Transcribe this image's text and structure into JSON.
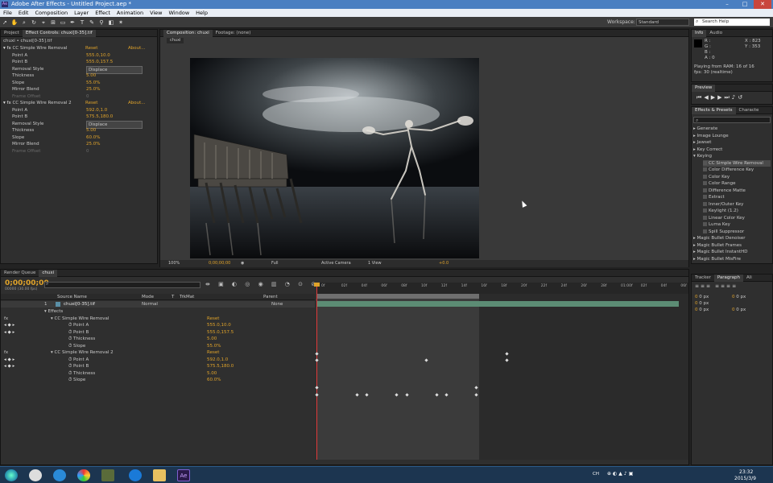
{
  "title": "Adobe After Effects - Untitled Project.aep *",
  "menu": [
    "File",
    "Edit",
    "Composition",
    "Layer",
    "Effect",
    "Animation",
    "View",
    "Window",
    "Help"
  ],
  "workspace": {
    "label": "Workspace:",
    "value": "Standard",
    "search": "Search Help"
  },
  "project_tab": "Project",
  "effect_controls": {
    "tab": "Effect Controls: chuxi[0-35].tif",
    "header": "chuxi • chuxi[0-35].tif",
    "effects": [
      {
        "name": "CC Simple Wire Removal",
        "reset": "Reset",
        "about": "About...",
        "props": [
          {
            "n": "Point A",
            "v": "555.0,10.0"
          },
          {
            "n": "Point B",
            "v": "555.0,157.5"
          },
          {
            "n": "Removal Style",
            "v": "Displace"
          },
          {
            "n": "Thickness",
            "v": "5.00"
          },
          {
            "n": "Slope",
            "v": "55.0%"
          },
          {
            "n": "Mirror Blend",
            "v": "25.0%"
          },
          {
            "n": "Frame Offset",
            "v": "0"
          }
        ]
      },
      {
        "name": "CC Simple Wire Removal 2",
        "reset": "Reset",
        "about": "About...",
        "props": [
          {
            "n": "Point A",
            "v": "592.0,1.0"
          },
          {
            "n": "Point B",
            "v": "575.5,180.0"
          },
          {
            "n": "Removal Style",
            "v": "Displace"
          },
          {
            "n": "Thickness",
            "v": "5.00"
          },
          {
            "n": "Slope",
            "v": "60.0%"
          },
          {
            "n": "Mirror Blend",
            "v": "25.0%"
          },
          {
            "n": "Frame Offset",
            "v": "0"
          }
        ]
      }
    ]
  },
  "composition": {
    "tab": "Composition: chuxi",
    "footage_tab": "Footage: (none)",
    "crumb": "chuxi",
    "zoom": "100%",
    "timecode": "0;00;00;00",
    "resolution": "Full",
    "camera": "Active Camera",
    "views": "1 View",
    "exposure": "+0.0"
  },
  "info": {
    "tabs": [
      "Info",
      "Audio"
    ],
    "r": "R :",
    "g": "G :",
    "b": "B :",
    "a": "A : 0",
    "x": "X : 823",
    "y": "Y : 353",
    "line1": "Playing from RAM: 16 of 16",
    "line2": "fps: 30 (realtime)"
  },
  "preview_tab": "Preview",
  "effects_presets": {
    "tabs": [
      "Effects & Presets",
      "Characte"
    ],
    "categories": [
      "Generate",
      "Image Lounge",
      "Jawset",
      "Key Correct",
      "Keying"
    ],
    "keying": [
      "CC Simple Wire Removal",
      "Color Difference Key",
      "Color Key",
      "Color Range",
      "Difference Matte",
      "Extract",
      "Inner/Outer Key",
      "Keylight (1.2)",
      "Linear Color Key",
      "Luma Key",
      "Spill Suppressor"
    ],
    "more": [
      "Magic Bullet Denoiser",
      "Magic Bullet Frames",
      "Magic Bullet InstantHD",
      "Magic Bullet MisFire"
    ]
  },
  "tracker_tabs": [
    "Tracker",
    "Paragraph",
    "Ali"
  ],
  "paragraph_units": [
    "0 px",
    "0 px",
    "0 px",
    "0 px",
    "0 px"
  ],
  "timeline": {
    "tabs": [
      "Render Queue",
      "chuxi"
    ],
    "timecode": "0;00;00;00",
    "sub": "00000 (30.00 fps)",
    "cols": [
      "Source Name",
      "Mode",
      "T",
      "TrkMat",
      "Parent"
    ],
    "layer": {
      "num": "1",
      "name": "chuxi[0-35].tif",
      "mode": "Normal",
      "parent": "None"
    },
    "rows": [
      {
        "t": "Effects",
        "v": ""
      },
      {
        "t": "CC Simple Wire Removal",
        "v": "Reset"
      },
      {
        "t": "Point A",
        "v": "555.0,10.0"
      },
      {
        "t": "Point B",
        "v": "555.0,157.5"
      },
      {
        "t": "Thickness",
        "v": "5.00"
      },
      {
        "t": "Slope",
        "v": "55.0%"
      },
      {
        "t": "CC Simple Wire Removal 2",
        "v": "Reset"
      },
      {
        "t": "Point A",
        "v": "592.0,1.0"
      },
      {
        "t": "Point B",
        "v": "575.5,180.0"
      },
      {
        "t": "Thickness",
        "v": "5.00"
      },
      {
        "t": "Slope",
        "v": "60.0%"
      }
    ],
    "ruler": [
      "0f",
      "02f",
      "04f",
      "06f",
      "08f",
      "10f",
      "12f",
      "14f",
      "16f",
      "18f",
      "20f",
      "22f",
      "24f",
      "26f",
      "28f",
      "01:00f",
      "02f",
      "04f",
      "06f"
    ]
  },
  "taskbar": {
    "lang": "CH",
    "time": "23:32",
    "date": "2015/3/9"
  }
}
